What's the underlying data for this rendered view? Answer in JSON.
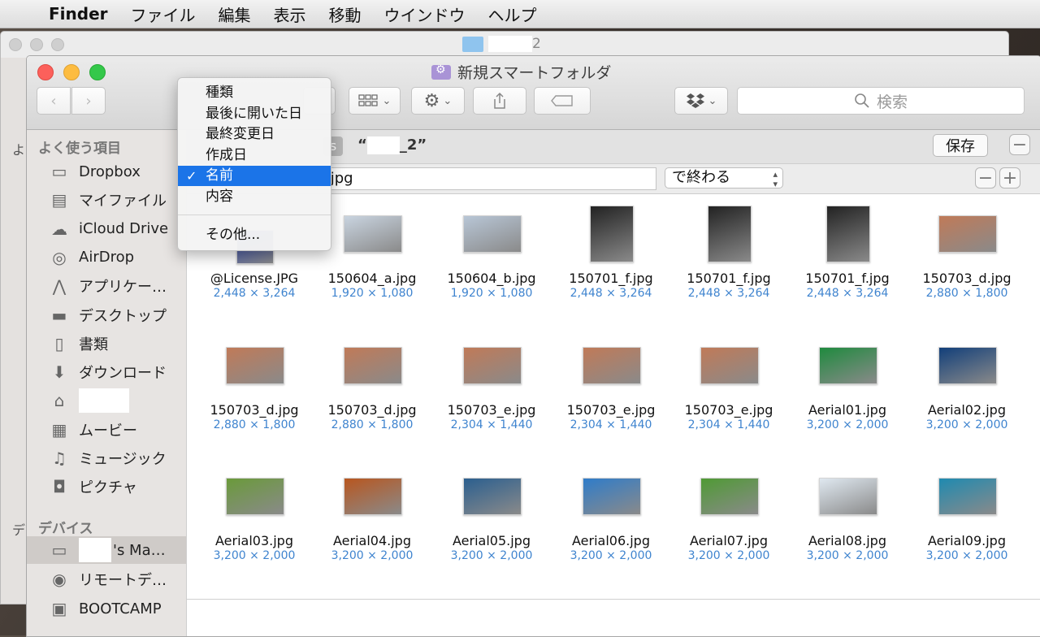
{
  "menubar": {
    "items": [
      "Finder",
      "ファイル",
      "編集",
      "表示",
      "移動",
      "ウインドウ",
      "ヘルプ"
    ]
  },
  "back_window": {
    "title_suffix": "2",
    "sidebar_fragments": [
      "よ",
      "よ",
      "デ"
    ]
  },
  "window": {
    "title": "新規スマートフォルダ",
    "search_placeholder": "検索"
  },
  "sidebar": {
    "favorites_header": "よく使う項目",
    "favorites": [
      {
        "label": "Dropbox",
        "icon": "folder-icon"
      },
      {
        "label": "マイファイル",
        "icon": "all-my-files-icon"
      },
      {
        "label": "iCloud Drive",
        "icon": "cloud-icon"
      },
      {
        "label": "AirDrop",
        "icon": "airdrop-icon"
      },
      {
        "label": "アプリケー…",
        "icon": "applications-icon"
      },
      {
        "label": "デスクトップ",
        "icon": "desktop-icon"
      },
      {
        "label": "書類",
        "icon": "documents-icon"
      },
      {
        "label": "ダウンロード",
        "icon": "downloads-icon"
      },
      {
        "label": "",
        "icon": "home-icon"
      },
      {
        "label": "ムービー",
        "icon": "movies-icon"
      },
      {
        "label": "ミュージック",
        "icon": "music-icon"
      },
      {
        "label": "ピクチャ",
        "icon": "pictures-icon"
      }
    ],
    "devices_header": "デバイス",
    "devices": [
      {
        "label": "'s Ma…",
        "icon": "laptop-icon"
      },
      {
        "label": "リモートデ…",
        "icon": "remote-disc-icon"
      },
      {
        "label": "BOOTCAMP",
        "icon": "drive-icon"
      }
    ]
  },
  "search_criteria": {
    "scope_quote_open": "“",
    "scope_suffix": "_2”",
    "save_label": "保存",
    "minus_label": "−",
    "plus_label": "+",
    "criteria_value": ".jpg",
    "criteria_operator": "で終わる"
  },
  "popup_menu": {
    "items": [
      "種類",
      "最後に開いた日",
      "最終変更日",
      "作成日",
      "名前",
      "内容"
    ],
    "selected": "名前",
    "other": "その他..."
  },
  "files": [
    {
      "name": "@License.JPG",
      "dims": "2,448 × 3,264"
    },
    {
      "name": "150604_a.jpg",
      "dims": "1,920 × 1,080"
    },
    {
      "name": "150604_b.jpg",
      "dims": "1,920 × 1,080"
    },
    {
      "name": "150701_f.jpg",
      "dims": "2,448 × 3,264"
    },
    {
      "name": "150701_f.jpg",
      "dims": "2,448 × 3,264"
    },
    {
      "name": "150701_f.jpg",
      "dims": "2,448 × 3,264"
    },
    {
      "name": "150703_d.jpg",
      "dims": "2,880 × 1,800"
    },
    {
      "name": "150703_d.jpg",
      "dims": "2,880 × 1,800"
    },
    {
      "name": "150703_d.jpg",
      "dims": "2,880 × 1,800"
    },
    {
      "name": "150703_e.jpg",
      "dims": "2,304 × 1,440"
    },
    {
      "name": "150703_e.jpg",
      "dims": "2,304 × 1,440"
    },
    {
      "name": "150703_e.jpg",
      "dims": "2,304 × 1,440"
    },
    {
      "name": "Aerial01.jpg",
      "dims": "3,200 × 2,000"
    },
    {
      "name": "Aerial02.jpg",
      "dims": "3,200 × 2,000"
    },
    {
      "name": "Aerial03.jpg",
      "dims": "3,200 × 2,000"
    },
    {
      "name": "Aerial04.jpg",
      "dims": "3,200 × 2,000"
    },
    {
      "name": "Aerial05.jpg",
      "dims": "3,200 × 2,000"
    },
    {
      "name": "Aerial06.jpg",
      "dims": "3,200 × 2,000"
    },
    {
      "name": "Aerial07.jpg",
      "dims": "3,200 × 2,000"
    },
    {
      "name": "Aerial08.jpg",
      "dims": "3,200 × 2,000"
    },
    {
      "name": "Aerial09.jpg",
      "dims": "3,200 × 2,000"
    }
  ]
}
